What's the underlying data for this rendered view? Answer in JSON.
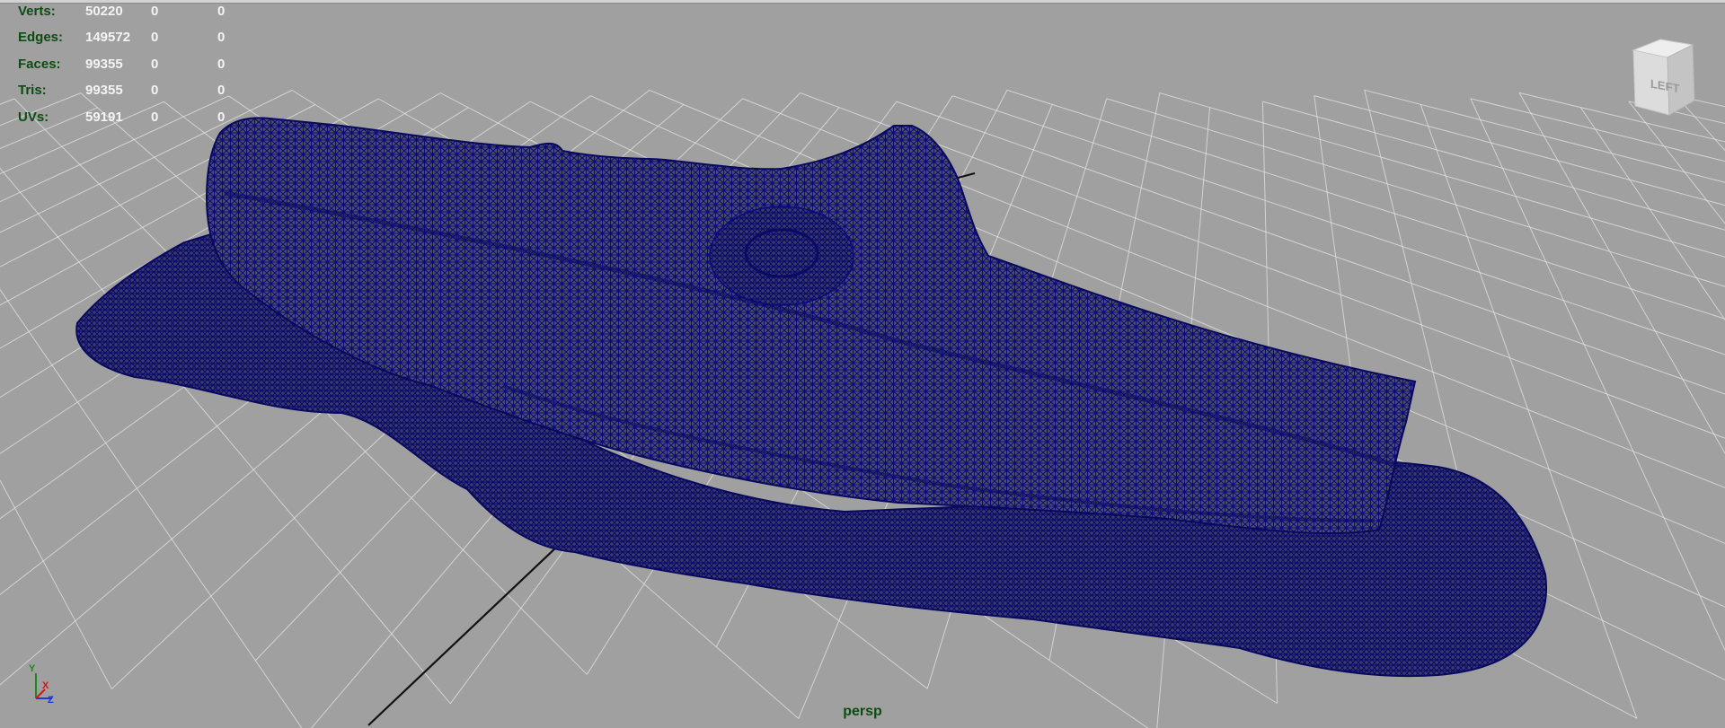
{
  "viewport": {
    "camera_name": "persp",
    "background_color": "#a0a0a0",
    "grid_color": "#e4e4e4",
    "wire_color": "#0a0a7a",
    "origin_axis_color": "#111111"
  },
  "hud": {
    "rows": [
      {
        "label": "Verts:",
        "v1": "50220",
        "v2": "0",
        "v3": "0"
      },
      {
        "label": "Edges:",
        "v1": "149572",
        "v2": "0",
        "v3": "0"
      },
      {
        "label": "Faces:",
        "v1": "99355",
        "v2": "0",
        "v3": "0"
      },
      {
        "label": "Tris:",
        "v1": "99355",
        "v2": "0",
        "v3": "0"
      },
      {
        "label": "UVs:",
        "v1": "59191",
        "v2": "0",
        "v3": "0"
      }
    ]
  },
  "viewcube": {
    "face_label": "LEFT"
  },
  "axis_indicator": {
    "y_label": "Y",
    "x_label": "X",
    "z_label": "Z"
  }
}
